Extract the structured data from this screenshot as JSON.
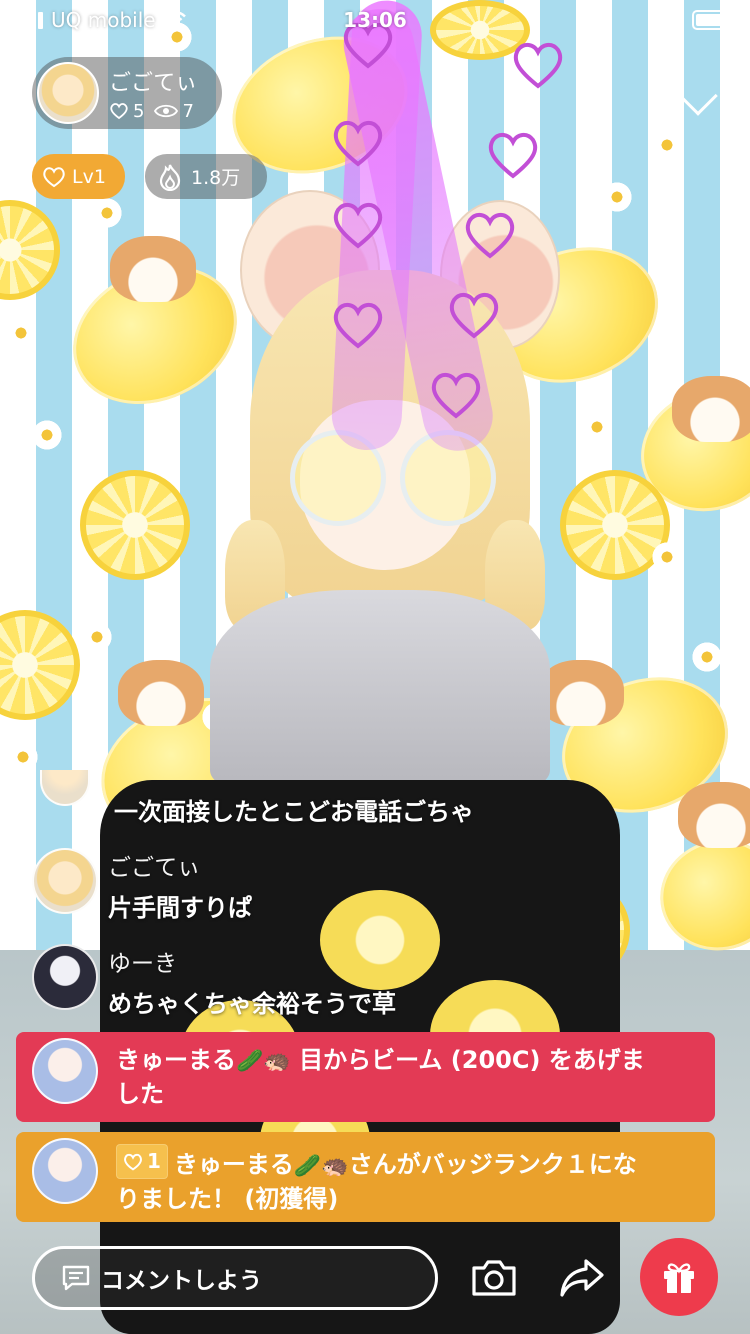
{
  "status_bar": {
    "carrier": "UQ mobile",
    "time": "13:06",
    "battery_level_percent": 85
  },
  "host": {
    "name": "ごごてぃ",
    "likes": "5",
    "viewers": "7"
  },
  "badges": {
    "level": "Lv1",
    "popularity": "1.8万"
  },
  "chat": [
    {
      "user": "",
      "text": "一次面接したとこどお電話ごちゃ"
    },
    {
      "user": "ごごてぃ",
      "text": "片手間すりぱ"
    },
    {
      "user": "ゆーき",
      "text": "めちゃくちゃ余裕そうで草"
    }
  ],
  "gift_banners": [
    {
      "user": "きゅーまる",
      "emojis": "🥒🦔",
      "line1_rest": " 目からビーム (200C) をあげま",
      "line2": "した",
      "color": "#e33a55"
    },
    {
      "badge_number": "1",
      "user": "きゅーまる",
      "emojis": "🥒🦔",
      "line1_rest": "さんがバッジランク１にな",
      "line2": "りました！ (初獲得)",
      "color": "#eaa12c"
    }
  ],
  "bottom_bar": {
    "comment_placeholder": "コメントしよう"
  },
  "icons": {
    "comment": "comment-bubble-icon",
    "camera": "camera-icon",
    "share": "share-arrow-icon",
    "gift": "gift-icon"
  }
}
